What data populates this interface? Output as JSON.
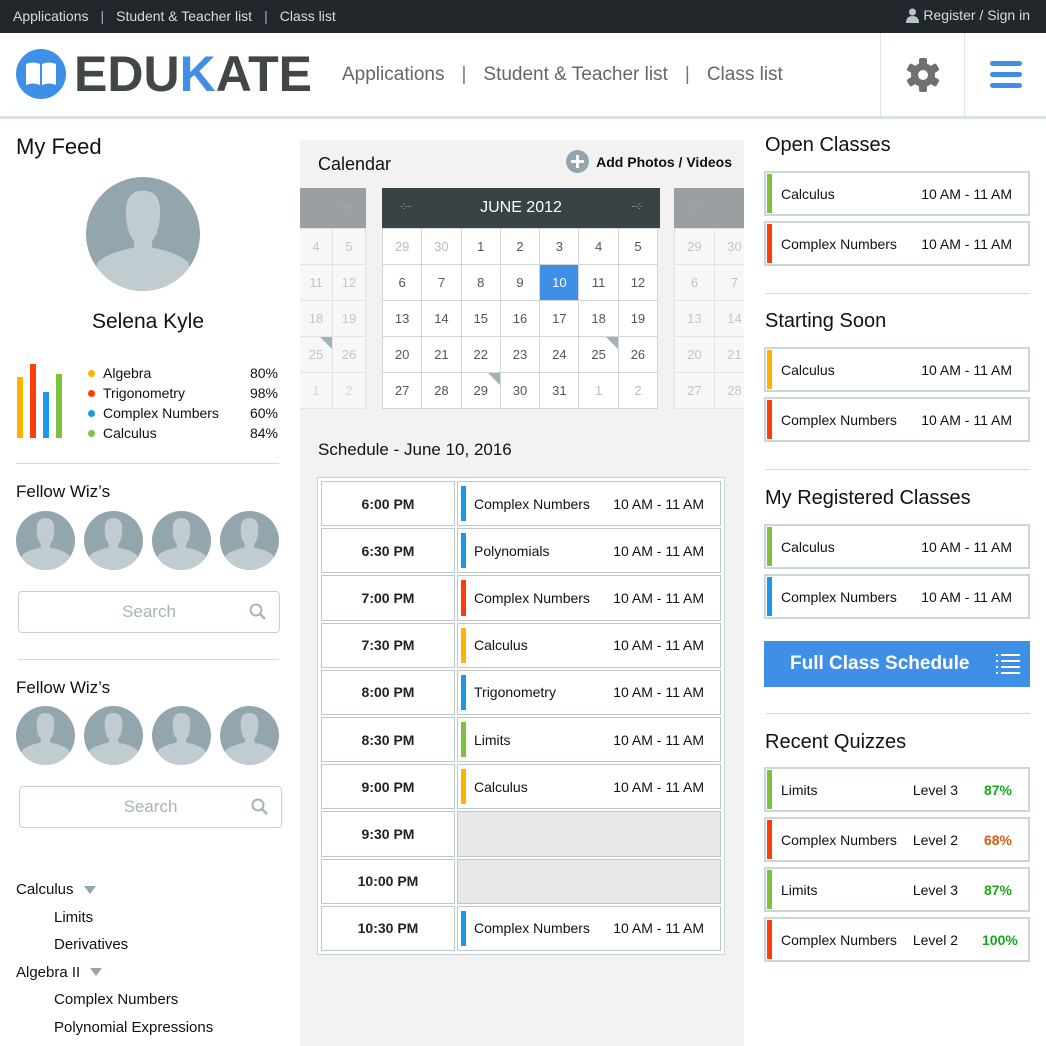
{
  "topbar": {
    "links": [
      "Applications",
      "Student & Teacher list",
      "Class list"
    ],
    "separator": "|",
    "register": "Register / Sign in",
    "register_icon": "user-icon"
  },
  "header": {
    "logo": {
      "prefix": "EDU",
      "accent": "K",
      "suffix": "ATE",
      "icon": "open-book-icon"
    },
    "nav": [
      "Applications",
      "Student & Teacher list",
      "Class list"
    ],
    "separator": "|",
    "settings_icon": "gear-icon",
    "menu_icon": "hamburger-menu-icon"
  },
  "colors": {
    "accent": "#3f8fe6",
    "dark": "#21272b",
    "orange": "#ffb300",
    "red": "#ff3d0a",
    "blue": "#1c96e8",
    "green": "#7ec13c",
    "score_good": "#19a81a",
    "score_mid": "#d95a0e"
  },
  "feed": {
    "title": "My Feed",
    "user_name": "Selena Kyle",
    "stats": [
      {
        "name": "Algebra",
        "value": "80%",
        "fraction": 0.8,
        "color": "#ffb300"
      },
      {
        "name": "Trigonometry",
        "value": "98%",
        "fraction": 0.98,
        "color": "#ff3d0a"
      },
      {
        "name": "Complex Numbers",
        "value": "60%",
        "fraction": 0.6,
        "color": "#1c96e8"
      },
      {
        "name": "Calculus",
        "value": "84%",
        "fraction": 0.84,
        "color": "#7ec13c"
      }
    ],
    "fellow_sections": [
      {
        "title": "Fellow Wiz’s",
        "search_placeholder": "Search"
      },
      {
        "title": "Fellow Wiz’s",
        "search_placeholder": "Search"
      }
    ],
    "tree": [
      {
        "label": "Calculus",
        "children": [
          "Limits",
          "Derivatives"
        ]
      },
      {
        "label": "Algebra II",
        "children": [
          "Complex Numbers",
          "Polynomial Expressions"
        ]
      }
    ]
  },
  "calendar": {
    "title": "Calendar",
    "add_label": "Add Photos / Videos",
    "month": "JUNE 2012",
    "selected_day": "10",
    "weeks": [
      [
        "29",
        "30",
        "1",
        "2",
        "3",
        "4",
        "5"
      ],
      [
        "6",
        "7",
        "8",
        "9",
        "10",
        "11",
        "12"
      ],
      [
        "13",
        "14",
        "15",
        "16",
        "17",
        "18",
        "19"
      ],
      [
        "20",
        "21",
        "22",
        "23",
        "24",
        "25",
        "26"
      ],
      [
        "27",
        "28",
        "29",
        "30",
        "31",
        "1",
        "2"
      ]
    ],
    "prev_weeks": [
      [
        "4",
        "5"
      ],
      [
        "11",
        "12"
      ],
      [
        "18",
        "19"
      ],
      [
        "25",
        "26"
      ],
      [
        "1",
        "2"
      ]
    ],
    "next_weeks": [
      [
        "29",
        "30"
      ],
      [
        "6",
        "7"
      ],
      [
        "13",
        "14"
      ],
      [
        "20",
        "21"
      ],
      [
        "27",
        "28"
      ]
    ]
  },
  "schedule": {
    "title": "Schedule - June 10, 2016",
    "rows": [
      {
        "time": "6:00 PM",
        "name": "Complex Numbers",
        "range": "10 AM - 11 AM",
        "color": "#1c96e8"
      },
      {
        "time": "6:30 PM",
        "name": "Polynomials",
        "range": "10 AM - 11 AM",
        "color": "#1c96e8"
      },
      {
        "time": "7:00 PM",
        "name": "Complex Numbers",
        "range": "10 AM - 11 AM",
        "color": "#ff3d0a"
      },
      {
        "time": "7:30 PM",
        "name": "Calculus",
        "range": "10 AM - 11 AM",
        "color": "#ffb300"
      },
      {
        "time": "8:00 PM",
        "name": "Trigonometry",
        "range": "10 AM - 11 AM",
        "color": "#1c96e8"
      },
      {
        "time": "8:30 PM",
        "name": "Limits",
        "range": "10 AM - 11 AM",
        "color": "#7ec13c"
      },
      {
        "time": "9:00 PM",
        "name": "Calculus",
        "range": "10 AM - 11 AM",
        "color": "#ffb300"
      },
      {
        "time": "9:30 PM",
        "name": "",
        "range": "",
        "color": ""
      },
      {
        "time": "10:00 PM",
        "name": "",
        "range": "",
        "color": ""
      },
      {
        "time": "10:30 PM",
        "name": "Complex Numbers",
        "range": "10 AM - 11 AM",
        "color": "#1c96e8"
      }
    ]
  },
  "right": {
    "open_classes": {
      "title": "Open Classes",
      "items": [
        {
          "name": "Calculus",
          "range": "10 AM - 11 AM",
          "color": "#7ec13c"
        },
        {
          "name": "Complex Numbers",
          "range": "10 AM - 11 AM",
          "color": "#ff3d0a"
        }
      ]
    },
    "starting_soon": {
      "title": "Starting Soon",
      "items": [
        {
          "name": "Calculus",
          "range": "10 AM - 11 AM",
          "color": "#ffb300"
        },
        {
          "name": "Complex Numbers",
          "range": "10 AM - 11 AM",
          "color": "#ff3d0a"
        }
      ]
    },
    "registered": {
      "title": "My Registered Classes",
      "items": [
        {
          "name": "Calculus",
          "range": "10 AM - 11 AM",
          "color": "#7ec13c"
        },
        {
          "name": "Complex Numbers",
          "range": "10 AM - 11 AM",
          "color": "#1c96e8"
        }
      ]
    },
    "full_schedule_button": "Full Class Schedule",
    "quizzes": {
      "title": "Recent Quizzes",
      "items": [
        {
          "name": "Limits",
          "level": "Level 3",
          "score": "87%",
          "color": "#7ec13c",
          "score_color": "#19a81a"
        },
        {
          "name": "Complex Numbers",
          "level": "Level 2",
          "score": "68%",
          "color": "#ff3d0a",
          "score_color": "#d95a0e"
        },
        {
          "name": "Limits",
          "level": "Level 3",
          "score": "87%",
          "color": "#7ec13c",
          "score_color": "#19a81a"
        },
        {
          "name": "Complex Numbers",
          "level": "Level 2",
          "score": "100%",
          "color": "#ff3d0a",
          "score_color": "#19a81a"
        }
      ]
    }
  }
}
